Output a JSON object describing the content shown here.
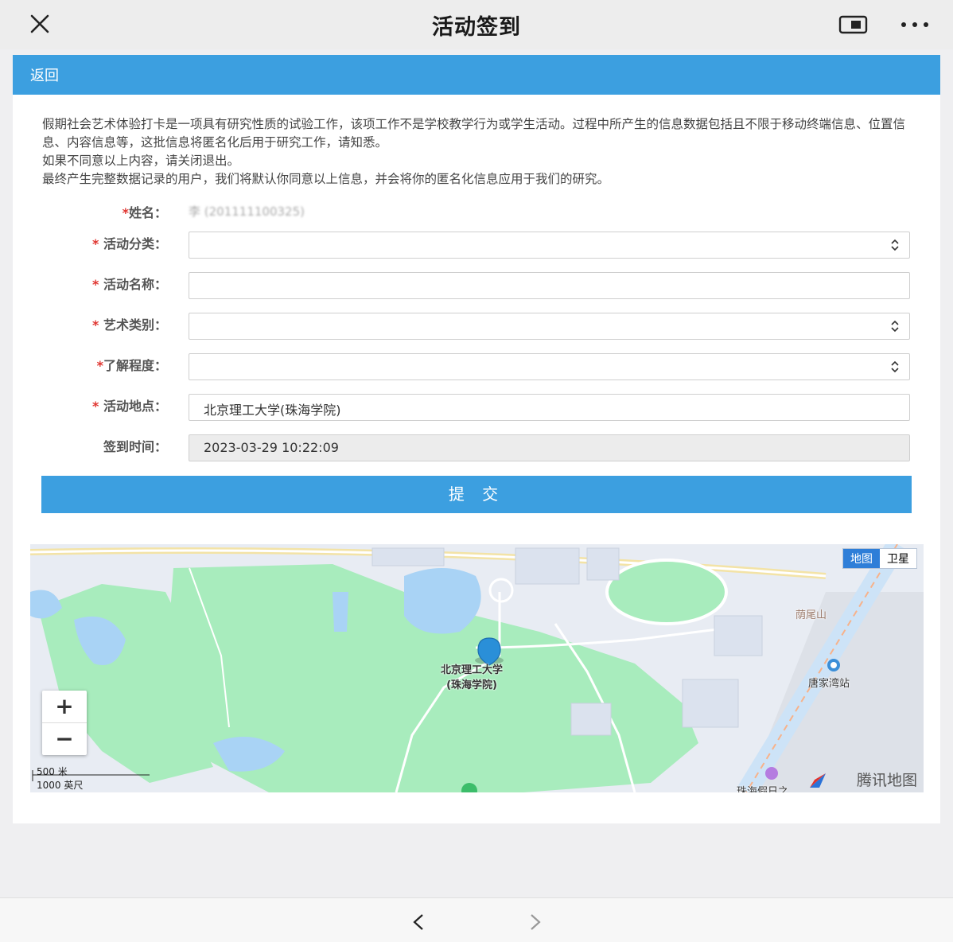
{
  "header": {
    "title": "活动签到"
  },
  "nav": {
    "back_label": "返回"
  },
  "notice": {
    "line1": "假期社会艺术体验打卡是一项具有研究性质的试验工作，该项工作不是学校教学行为或学生活动。过程中所产生的信息数据包括且不限于移动终端信息、位置信息、内容信息等，这批信息将匿名化后用于研究工作，请知悉。",
    "line2": "如果不同意以上内容，请关闭退出。",
    "line3": "最终产生完整数据记录的用户，我们将默认你同意以上信息，并会将你的匿名化信息应用于我们的研究。"
  },
  "form": {
    "name_label": "姓名：",
    "name_value": "李 (201111100325)",
    "category_label": "活动分类：",
    "category_value": "",
    "activity_name_label": "活动名称：",
    "activity_name_value": "",
    "art_type_label": "艺术类别：",
    "art_type_value": "",
    "understanding_label": "了解程度：",
    "understanding_value": "",
    "location_label": "活动地点：",
    "location_value": "北京理工大学(珠海学院)",
    "time_label": "签到时间：",
    "time_value": "2023-03-29 10:22:09",
    "required_mark": "*",
    "submit_label": "提 交"
  },
  "map": {
    "type_map": "地图",
    "type_satellite": "卫星",
    "zoom_in": "+",
    "zoom_out": "−",
    "scale_metric": "500 米",
    "scale_imperial": "1000 英尺",
    "marker_label_1": "北京理工大学",
    "marker_label_2": "(珠海学院)",
    "places": {
      "shan": "荫尾山",
      "station": "唐家湾站",
      "resort": "珠海假日之"
    },
    "logo": "腾讯地图",
    "colors": {
      "green": "#a8ecbd",
      "water": "#a9d3f5",
      "land": "#e8ecf3",
      "road": "#ffffff",
      "marker": "#2a8fd8"
    }
  },
  "colors": {
    "accent": "#3c9fe0",
    "required": "#e0342f"
  }
}
